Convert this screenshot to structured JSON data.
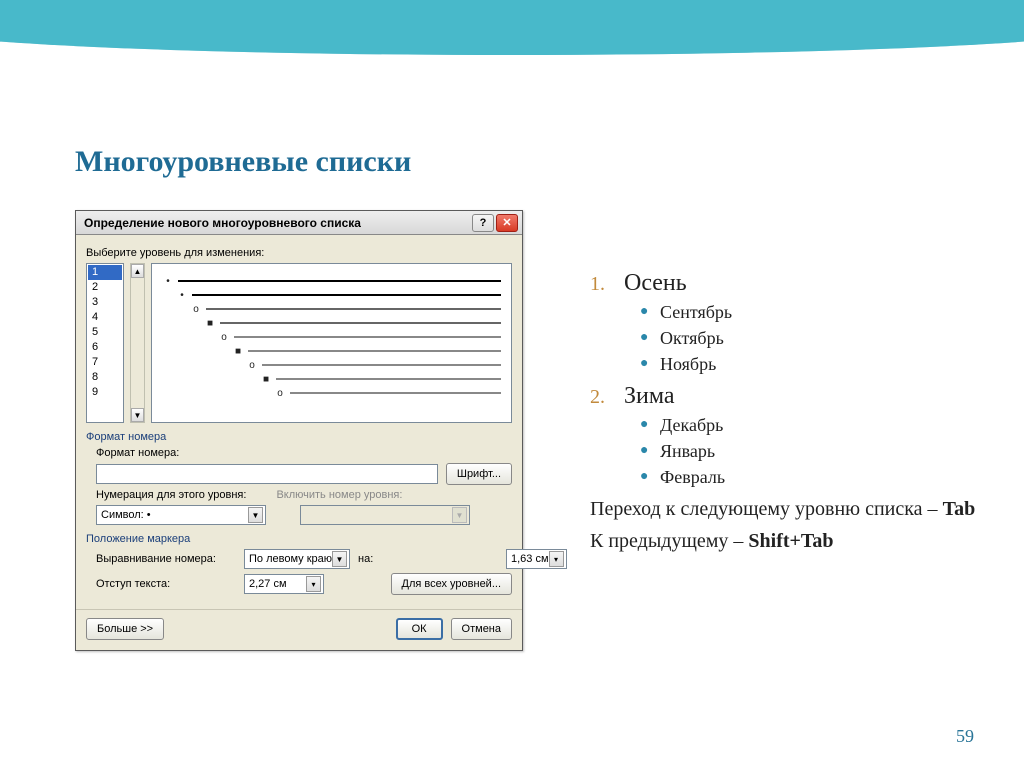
{
  "slide": {
    "title": "Многоуровневые списки",
    "page_number": "59"
  },
  "dialog": {
    "title": "Определение нового многоуровневого списка",
    "level_label": "Выберите уровень для изменения:",
    "levels": [
      "1",
      "2",
      "3",
      "4",
      "5",
      "6",
      "7",
      "8",
      "9"
    ],
    "selected_level": "1",
    "preview_markers": [
      "•",
      "•",
      "o",
      "■",
      "o",
      "■",
      "o",
      "■",
      "o"
    ],
    "section_format": "Формат номера",
    "format_label": "Формат номера:",
    "format_value": "",
    "font_button": "Шрифт...",
    "numbering_label": "Нумерация для этого уровня:",
    "numbering_value": "Символ: •",
    "include_level_label": "Включить номер уровня:",
    "section_position": "Положение маркера",
    "align_label": "Выравнивание номера:",
    "align_value": "По левому краю",
    "at_label": "на:",
    "at_value": "1,63 см",
    "indent_label": "Отступ текста:",
    "indent_value": "2,27 см",
    "all_levels_button": "Для всех уровней...",
    "more_button": "Больше >>",
    "ok_button": "ОК",
    "cancel_button": "Отмена"
  },
  "list": {
    "items": [
      {
        "num": "1.",
        "label": "Осень",
        "children": [
          "Сентябрь",
          "Октябрь",
          "Ноябрь"
        ]
      },
      {
        "num": "2.",
        "label": "Зима",
        "children": [
          "Декабрь",
          "Январь",
          "Февраль"
        ]
      }
    ],
    "tip1_a": "Переход к следующему уровню списка – ",
    "tip1_b": "Tab",
    "tip2_a": "К предыдущему – ",
    "tip2_b": "Shift+Tab"
  }
}
